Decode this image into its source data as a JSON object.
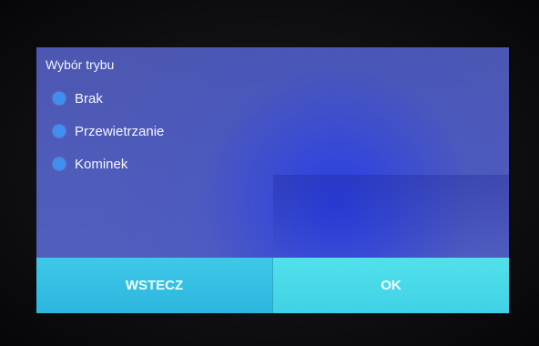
{
  "dialog": {
    "title": "Wybór trybu",
    "options": [
      {
        "label": "Brak"
      },
      {
        "label": "Przewietrzanie"
      },
      {
        "label": "Kominek"
      }
    ],
    "buttons": {
      "back_label": "WSTECZ",
      "ok_label": "OK"
    }
  },
  "colors": {
    "radio": "#3f8ff0",
    "button_back": "#2db6de",
    "button_ok": "#3fd2e6",
    "background": "#4f5bb8"
  }
}
